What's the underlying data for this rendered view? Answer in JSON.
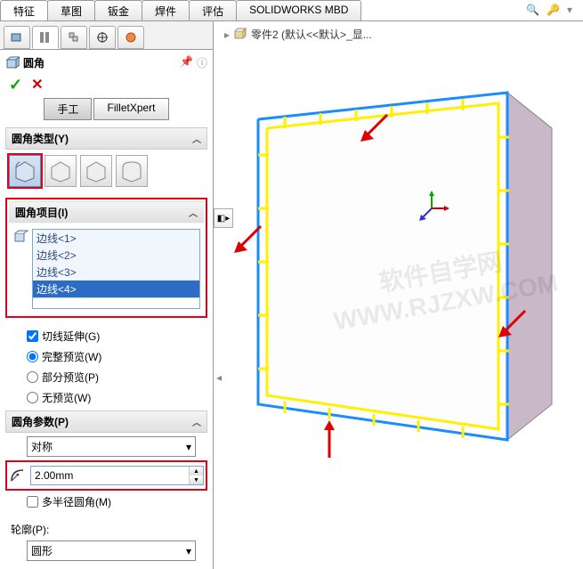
{
  "tabs": {
    "t0": "特征",
    "t1": "草图",
    "t2": "钣金",
    "t3": "焊件",
    "t4": "评估",
    "t5": "SOLIDWORKS MBD"
  },
  "feature": {
    "title": "圆角"
  },
  "modes": {
    "manual": "手工",
    "xpert": "FilletXpert"
  },
  "sections": {
    "type": "圆角类型(Y)",
    "items": "圆角项目(I)",
    "params": "圆角参数(P)",
    "profile": "轮廓(P):"
  },
  "edges": {
    "e1": "边线<1>",
    "e2": "边线<2>",
    "e3": "边线<3>",
    "e4": "边线<4>"
  },
  "options": {
    "tangent": "切线延伸(G)",
    "fullprev": "完整预览(W)",
    "partprev": "部分预览(P)",
    "noprev": "无预览(W)"
  },
  "params": {
    "sym": "对称",
    "radius": "2.00mm",
    "multicheck": "多半径圆角(M)",
    "profile": "圆形"
  },
  "breadcrumb": {
    "part": "零件2  (默认<<默认>_显..."
  },
  "watermark": "软件自学网\nWWW.RJZXW.COM"
}
